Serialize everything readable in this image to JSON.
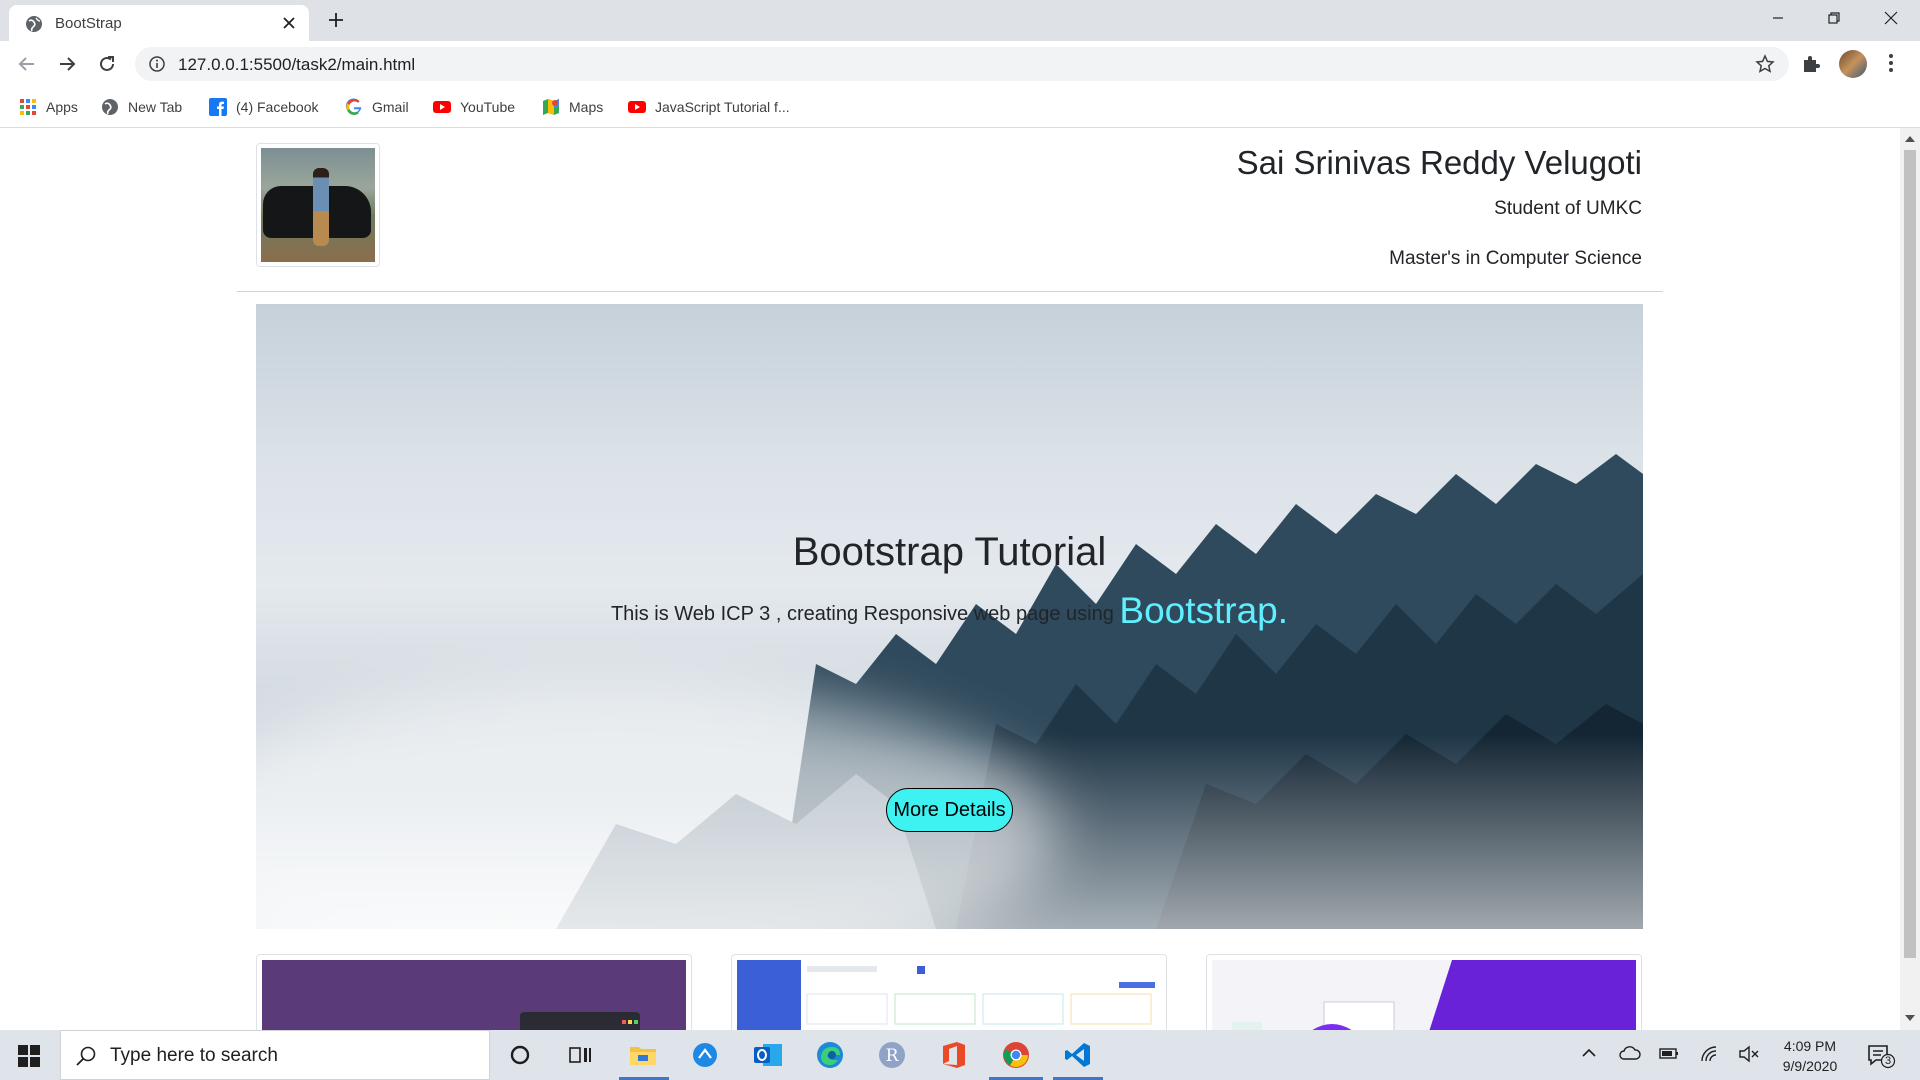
{
  "browser": {
    "tab_title": "BootStrap",
    "url": "127.0.0.1:5500/task2/main.html",
    "bookmarks": [
      {
        "label": "Apps",
        "icon": "apps-grid-icon"
      },
      {
        "label": "New Tab",
        "icon": "globe-icon"
      },
      {
        "label": "(4) Facebook",
        "icon": "facebook-icon"
      },
      {
        "label": "Gmail",
        "icon": "google-icon"
      },
      {
        "label": "YouTube",
        "icon": "youtube-icon"
      },
      {
        "label": "Maps",
        "icon": "maps-icon"
      },
      {
        "label": "JavaScript Tutorial f...",
        "icon": "youtube-icon"
      }
    ]
  },
  "page": {
    "header": {
      "name": "Sai Srinivas Reddy Velugoti",
      "line1": "Student of UMKC",
      "line2": "Master's in Computer Science"
    },
    "hero": {
      "title": "Bootstrap Tutorial",
      "text": "This is Web ICP 3 , creating Responsive web page using",
      "highlight": "Bootstrap.",
      "button": "More Details",
      "highlight_color": "#5ff0ff",
      "button_color": "#3ff2f2"
    }
  },
  "taskbar": {
    "search_placeholder": "Type here to search",
    "time": "4:09 PM",
    "date": "9/9/2020",
    "notification_count": "3"
  }
}
